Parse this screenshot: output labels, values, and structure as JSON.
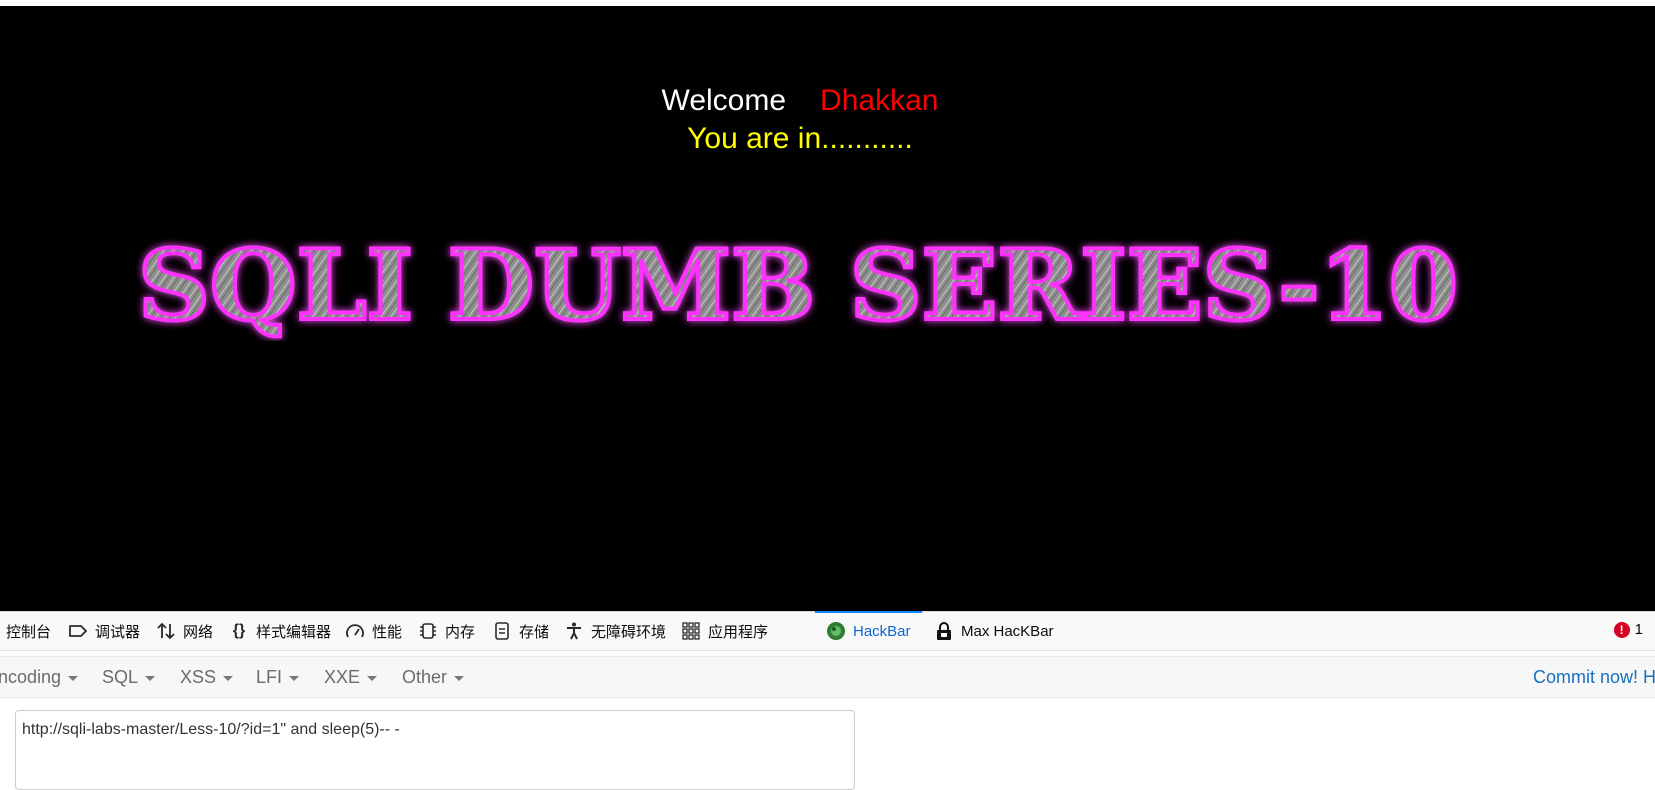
{
  "page": {
    "welcome_label": "Welcome",
    "user_name": "Dhakkan",
    "status_text": "You are in...........",
    "banner_text": "SQLI DUMB SERIES-10",
    "colors": {
      "background": "#000000",
      "welcome": "#ffffff",
      "user_name": "#ff0000",
      "status": "#ffff00",
      "banner_glow": "#ff00ff",
      "banner_fill": "#9a9a9a"
    }
  },
  "devtools": {
    "tabs": [
      {
        "label": "控制台",
        "icon": "console-icon"
      },
      {
        "label": "调试器",
        "icon": "debugger-icon"
      },
      {
        "label": "网络",
        "icon": "network-icon"
      },
      {
        "label": "样式编辑器",
        "icon": "style-editor-icon"
      },
      {
        "label": "性能",
        "icon": "performance-icon"
      },
      {
        "label": "内存",
        "icon": "memory-icon"
      },
      {
        "label": "存储",
        "icon": "storage-icon"
      },
      {
        "label": "无障碍环境",
        "icon": "accessibility-icon"
      },
      {
        "label": "应用程序",
        "icon": "application-icon"
      },
      {
        "label": "HackBar",
        "icon": "hackbar-icon",
        "active": true
      },
      {
        "label": "Max HacKBar",
        "icon": "lock-icon"
      }
    ],
    "error_count": "1"
  },
  "hackbar": {
    "menus": [
      "ncoding",
      "SQL",
      "XSS",
      "LFI",
      "XXE",
      "Other"
    ],
    "commit_text": "Commit now! Ha",
    "url_value": "http://sqli-labs-master/Less-10/?id=1\" and sleep(5)-- -"
  }
}
